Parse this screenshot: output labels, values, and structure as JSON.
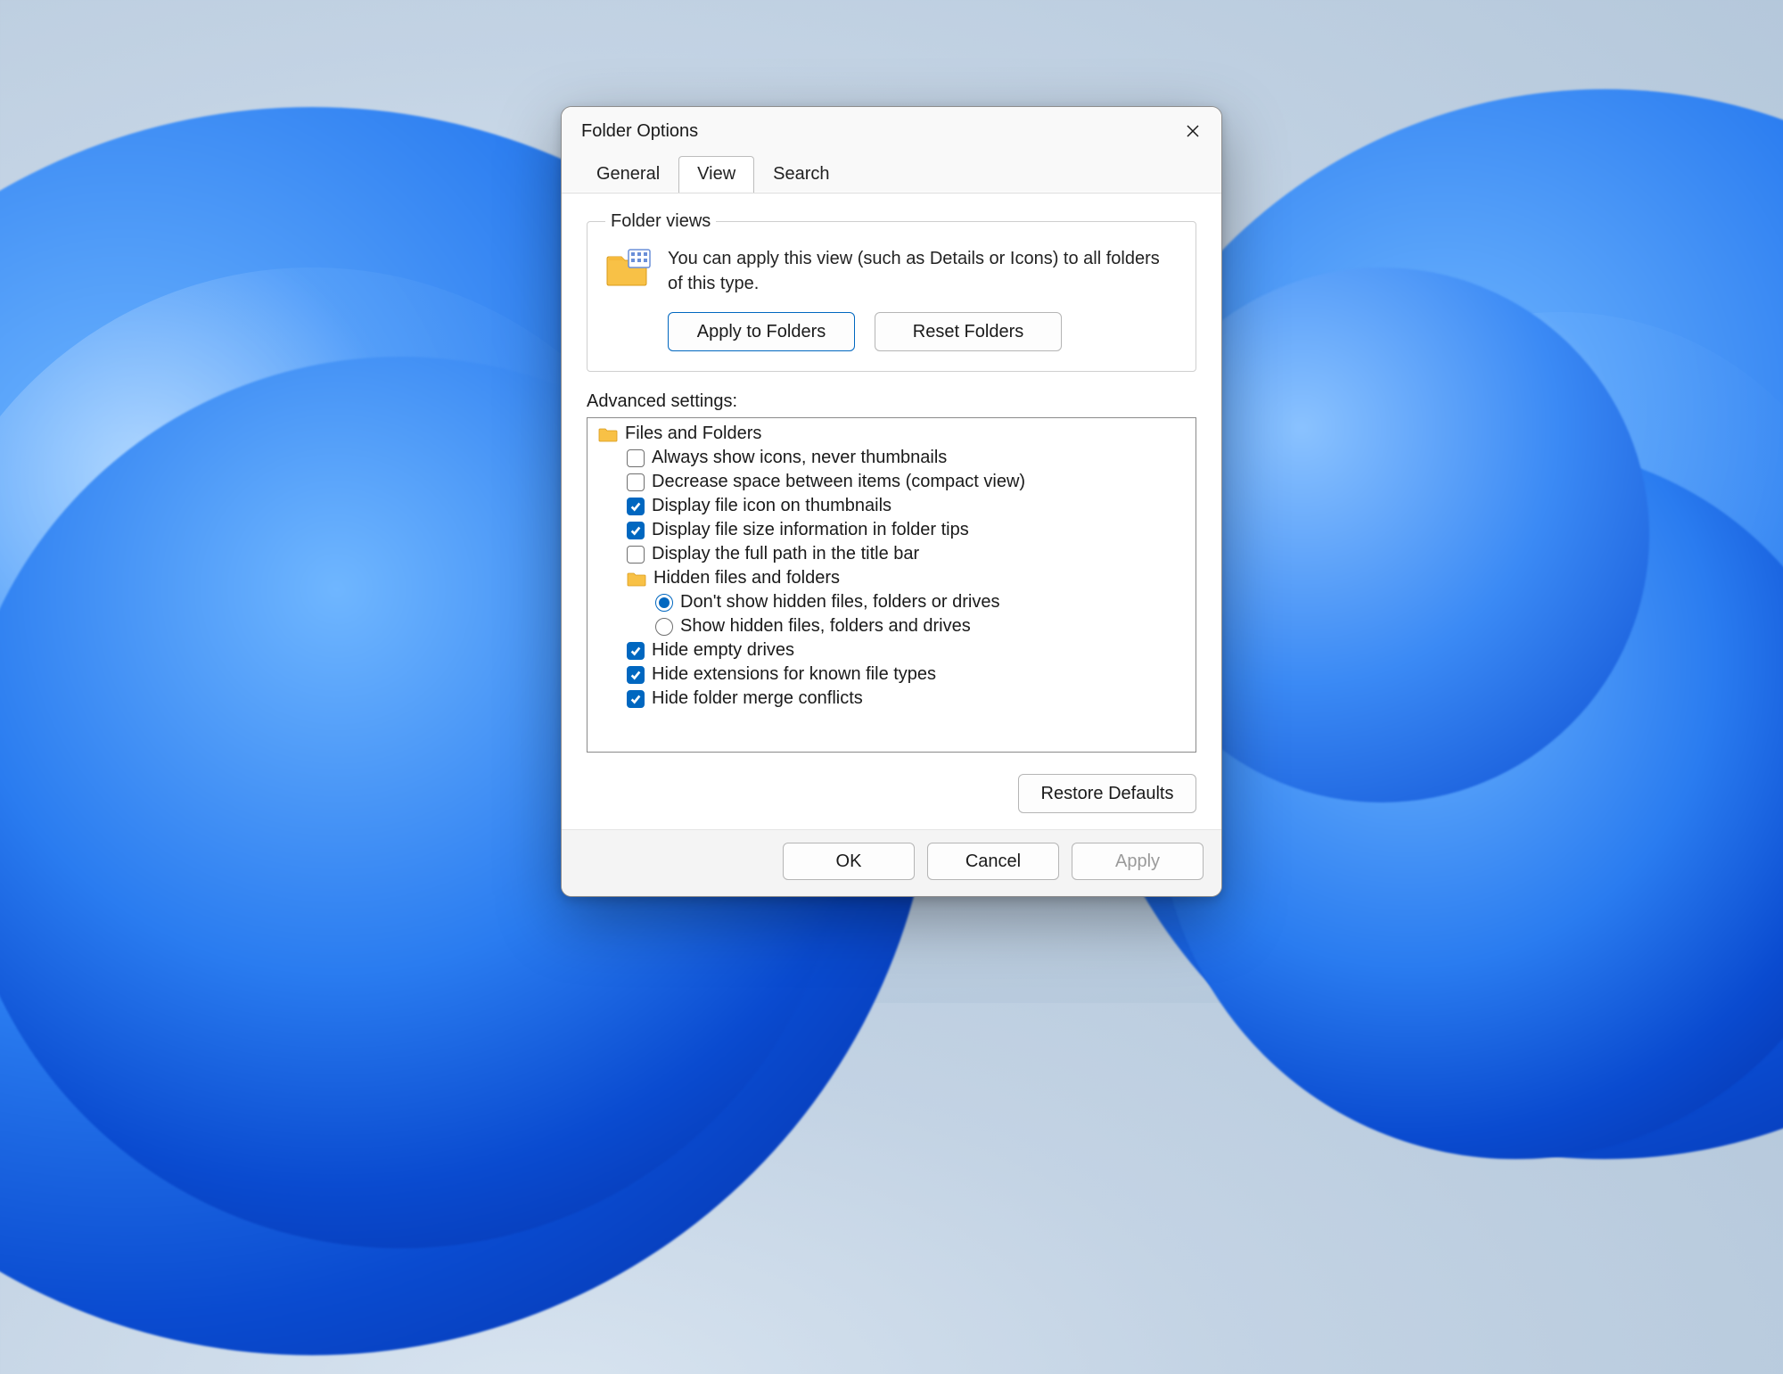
{
  "window": {
    "title": "Folder Options"
  },
  "tabs": {
    "general": "General",
    "view": "View",
    "search": "Search",
    "active": "view"
  },
  "folder_views": {
    "legend": "Folder views",
    "description": "You can apply this view (such as Details or Icons) to all folders of this type.",
    "apply_btn": "Apply to Folders",
    "reset_btn": "Reset Folders"
  },
  "advanced": {
    "label": "Advanced settings:",
    "root": "Files and Folders",
    "items": [
      {
        "type": "check",
        "checked": false,
        "label": "Always show icons, never thumbnails"
      },
      {
        "type": "check",
        "checked": false,
        "label": "Decrease space between items (compact view)"
      },
      {
        "type": "check",
        "checked": true,
        "label": "Display file icon on thumbnails"
      },
      {
        "type": "check",
        "checked": true,
        "label": "Display file size information in folder tips"
      },
      {
        "type": "check",
        "checked": false,
        "label": "Display the full path in the title bar"
      },
      {
        "type": "folder",
        "label": "Hidden files and folders"
      },
      {
        "type": "radio",
        "selected": true,
        "label": "Don't show hidden files, folders or drives"
      },
      {
        "type": "radio",
        "selected": false,
        "label": "Show hidden files, folders and drives"
      },
      {
        "type": "check",
        "checked": true,
        "label": "Hide empty drives"
      },
      {
        "type": "check",
        "checked": true,
        "label": "Hide extensions for known file types"
      },
      {
        "type": "check",
        "checked": true,
        "label": "Hide folder merge conflicts"
      }
    ],
    "restore_btn": "Restore Defaults"
  },
  "buttons": {
    "ok": "OK",
    "cancel": "Cancel",
    "apply": "Apply"
  }
}
